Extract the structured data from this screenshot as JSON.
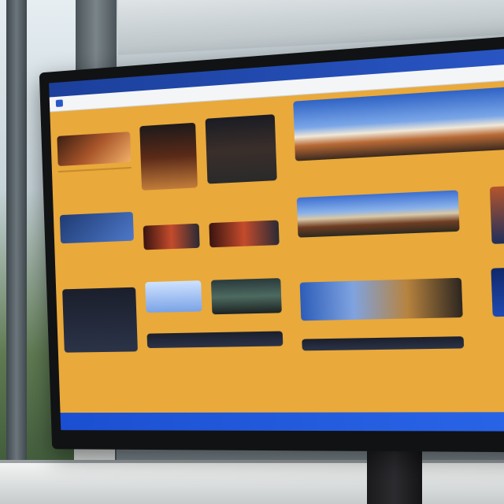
{
  "browser": {
    "address_text": "",
    "nav_text": "",
    "headline": ""
  },
  "monitor": {
    "brand": ""
  },
  "tiles": {
    "promo_1_label": "",
    "promo_2_label": "",
    "promo_right_label": ""
  },
  "colors": {
    "page_background": "#e9a93b",
    "browser_bar": "#2a57c7",
    "bottom_strip": "#1b4fd1"
  }
}
